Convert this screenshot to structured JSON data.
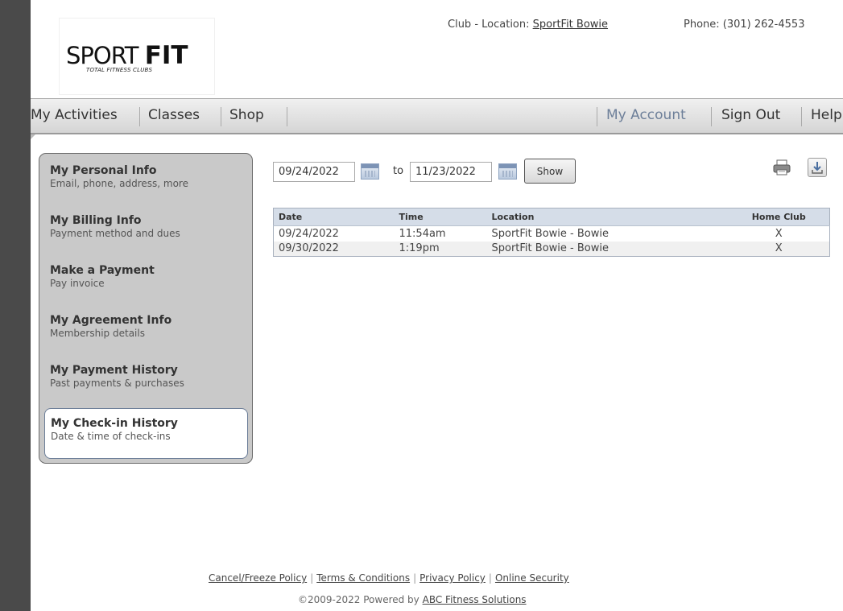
{
  "brand": {
    "logo_word_light": "SPORT",
    "logo_word_bold": "FIT",
    "logo_tagline": "TOTAL FITNESS CLUBS"
  },
  "header": {
    "club_location_label": "Club - Location:",
    "club_location_link": "SportFit Bowie",
    "phone_label": "Phone: (301) 262-4553"
  },
  "nav": {
    "left": [
      "My Activities",
      "Classes",
      "Shop"
    ],
    "right": [
      "My Account",
      "Sign Out",
      "Help"
    ],
    "active": "My Account"
  },
  "sidebar": {
    "items": [
      {
        "title": "My Personal Info",
        "desc": "Email, phone, address, more"
      },
      {
        "title": "My Billing Info",
        "desc": "Payment method and dues"
      },
      {
        "title": "Make a Payment",
        "desc": "Pay invoice"
      },
      {
        "title": "My Agreement Info",
        "desc": "Membership details"
      },
      {
        "title": "My Payment History",
        "desc": "Past payments & purchases"
      },
      {
        "title": "My Check-in History",
        "desc": "Date & time of check-ins"
      }
    ],
    "selected": "My Check-in History"
  },
  "filters": {
    "start_date": "09/24/2022",
    "to_label": "to",
    "end_date": "11/23/2022",
    "show_label": "Show"
  },
  "table": {
    "headers": [
      "Date",
      "Time",
      "Location",
      "Home Club"
    ],
    "rows": [
      [
        "09/24/2022",
        "11:54am",
        "SportFit Bowie - Bowie",
        "X"
      ],
      [
        "09/30/2022",
        "1:19pm",
        "SportFit Bowie - Bowie",
        "X"
      ]
    ]
  },
  "footer": {
    "links": [
      "Cancel/Freeze Policy",
      "Terms & Conditions",
      "Privacy Policy",
      "Online Security"
    ],
    "copyright_prefix": "©2009-2022 Powered by",
    "copyright_link": "ABC Fitness Solutions"
  },
  "colors": {
    "active_nav": "#6d7f99",
    "sidebar_bg": "#c9c9c9",
    "table_header_bg": "#d5dde8"
  }
}
